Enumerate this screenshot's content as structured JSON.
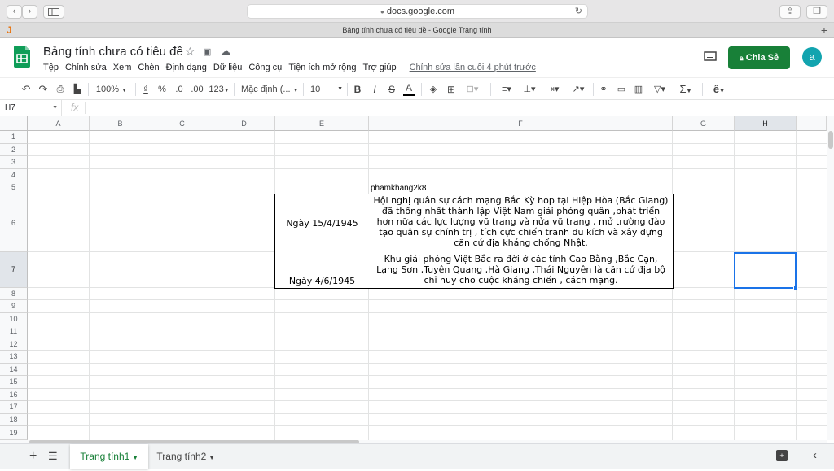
{
  "browser": {
    "url": "docs.google.com",
    "tab_title": "Bảng tính chưa có tiêu đề - Google Trang tính",
    "tab_letter": "J",
    "new_tab": "+"
  },
  "doc": {
    "title": "Bảng tính chưa có tiêu đề",
    "menu": [
      "Tệp",
      "Chỉnh sửa",
      "Xem",
      "Chèn",
      "Định dạng",
      "Dữ liệu",
      "Công cụ",
      "Tiện ích mở rộng",
      "Trợ giúp"
    ],
    "last_edit": "Chỉnh sửa lần cuối 4 phút trước",
    "share_label": "Chia Sẻ",
    "avatar_letter": "a"
  },
  "toolbar": {
    "zoom": "100%",
    "currency": "₫",
    "percent": "%",
    "dec_less": ".0",
    "dec_more": ".00",
    "format_more": "123",
    "font": "Mặc định (...",
    "font_size": "10",
    "bold": "B",
    "italic": "I",
    "strike": "S",
    "text_color": "A",
    "sum": "Σ",
    "input_tools": "ê"
  },
  "formula_bar": {
    "cell_ref": "H7",
    "fx": "fx",
    "value": ""
  },
  "grid": {
    "columns": [
      "A",
      "B",
      "C",
      "D",
      "E",
      "F",
      "G",
      "H"
    ],
    "rows": [
      "1",
      "2",
      "3",
      "4",
      "5",
      "6",
      "7",
      "8",
      "9",
      "10",
      "11",
      "12",
      "13",
      "14",
      "15",
      "16",
      "17",
      "18",
      "19"
    ],
    "f5": "phamkhang2k8",
    "e6": "Ngày 15/4/1945",
    "f6": "Hội nghị quân sự cách mạng Bắc Kỳ họp tại Hiệp Hòa (Bắc Giang) đã thống nhất thành lập Việt Nam giải phóng quân ,phát triển hơn nữa các lực lượng vũ trang và nửa vũ trang , mở trường đào tạo quân sự chính trị , tích cực chiến tranh du kích và xây dựng căn cứ địa kháng chống Nhật.",
    "e7": "Ngày 4/6/1945",
    "f7": "Khu giải phóng Việt Bắc ra đời ở các tỉnh Cao Bằng ,Bắc Cạn, Lạng Sơn ,Tuyên Quang ,Hà Giang ,Thái Nguyên là căn cứ địa bộ chỉ huy cho cuộc kháng chiến , cách mạng."
  },
  "sheets": {
    "tabs": [
      "Trang tính1",
      "Trang tính2"
    ],
    "add": "+"
  },
  "colors": {
    "green": "#188038",
    "share_green": "#1e8e3e",
    "selection": "#1a73e8",
    "avatar": "#12a4af"
  }
}
